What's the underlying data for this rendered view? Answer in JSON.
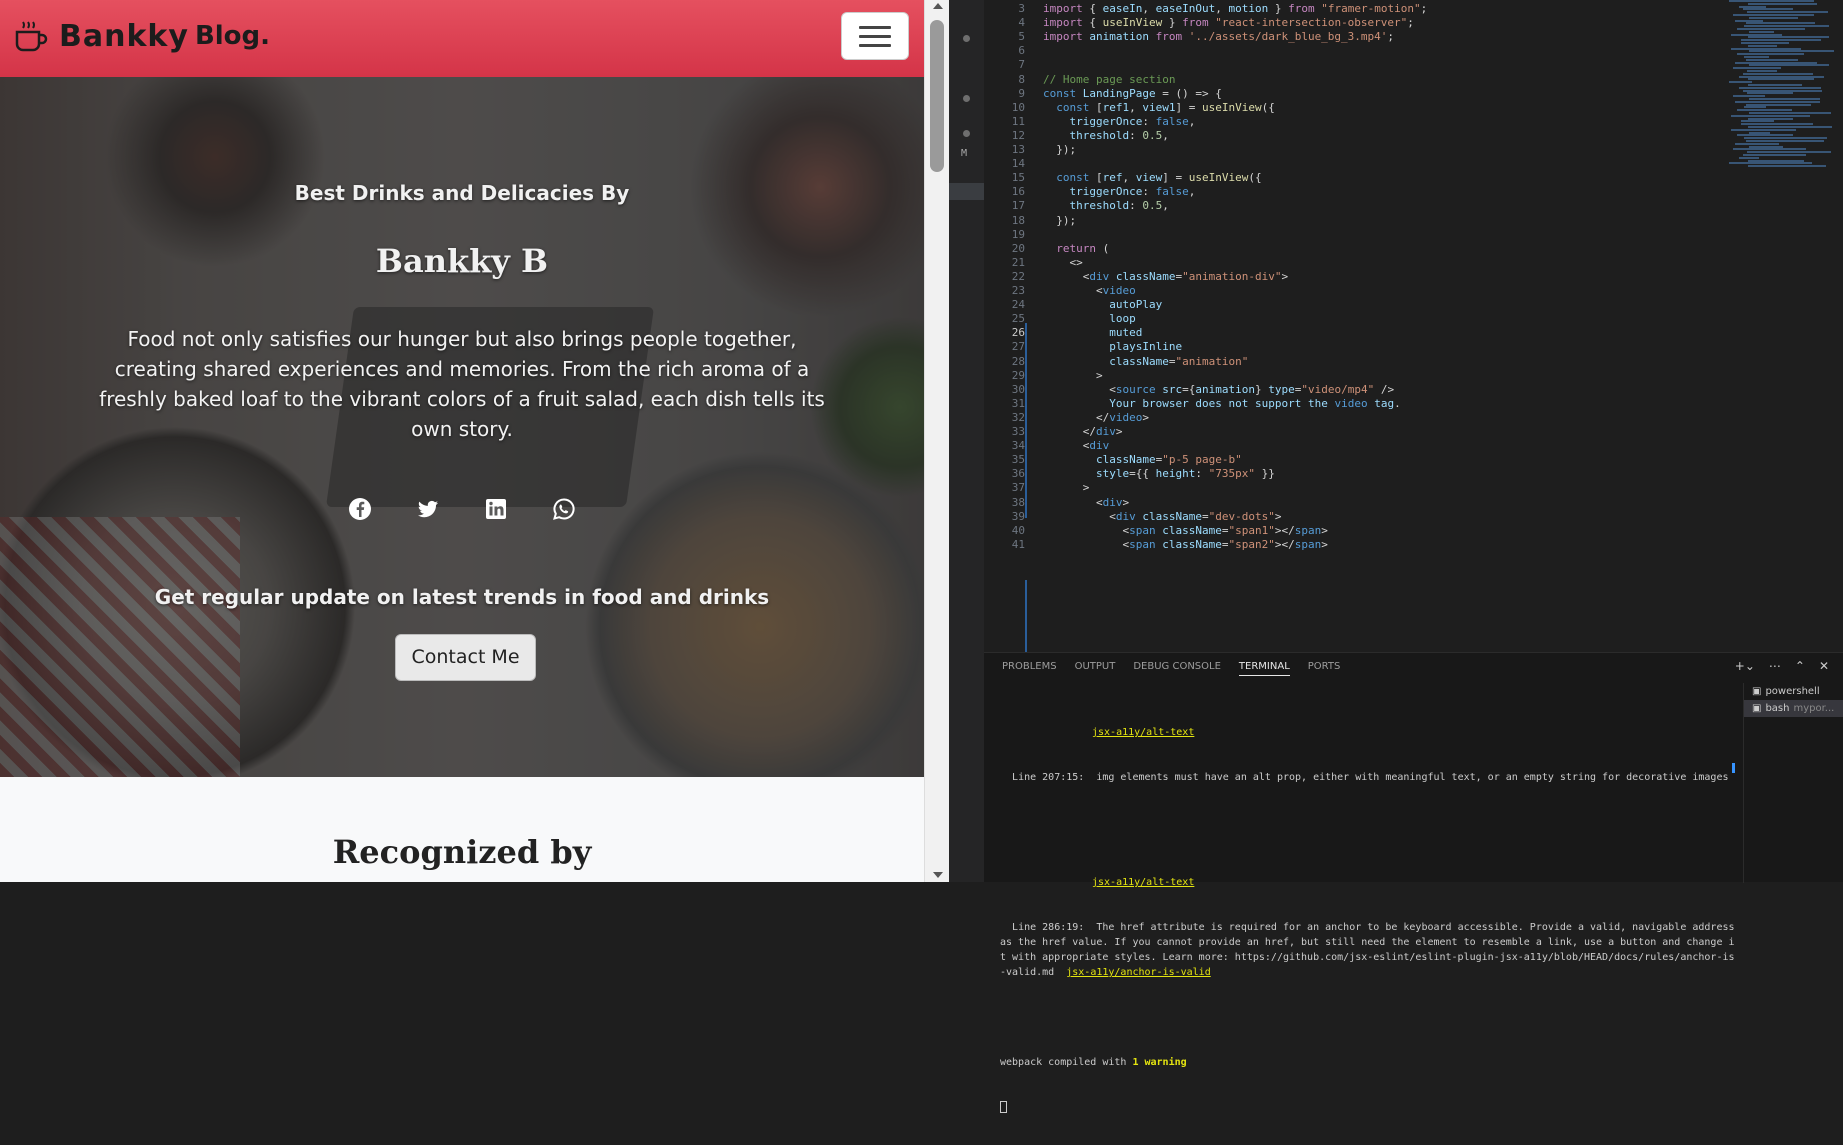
{
  "browser": {
    "navbar": {
      "brand_word": "Bankky",
      "brand_suffix": "Blog.",
      "toggler_label": "Toggle navigation"
    },
    "hero": {
      "subtitle": "Best Drinks and Delicacies By",
      "name": "Bankky B",
      "description": "Food not only satisfies our hunger but also brings people together, creating shared experiences and memories. From the rich aroma of a freshly baked loaf to the vibrant colors of a fruit salad, each dish tells its own story.",
      "social_icons": [
        "facebook-icon",
        "twitter-icon",
        "linkedin-icon",
        "whatsapp-icon"
      ],
      "update_text": "Get regular update on latest trends in food and drinks",
      "contact_button": "Contact Me"
    },
    "section_title": "Recognized by"
  },
  "editor": {
    "current_line": 26,
    "lines": [
      {
        "n": 3,
        "code": "import { easeIn, easeInOut, motion } from \"framer-motion\";"
      },
      {
        "n": 4,
        "code": "import { useInView } from \"react-intersection-observer\";"
      },
      {
        "n": 5,
        "code": "import animation from '../assets/dark_blue_bg_3.mp4';"
      },
      {
        "n": 6,
        "code": ""
      },
      {
        "n": 7,
        "code": ""
      },
      {
        "n": 8,
        "code": "// Home page section"
      },
      {
        "n": 9,
        "code": "const LandingPage = () => {"
      },
      {
        "n": 10,
        "code": "  const [ref1, view1] = useInView({"
      },
      {
        "n": 11,
        "code": "    triggerOnce: false,"
      },
      {
        "n": 12,
        "code": "    threshold: 0.5,"
      },
      {
        "n": 13,
        "code": "  });"
      },
      {
        "n": 14,
        "code": ""
      },
      {
        "n": 15,
        "code": "  const [ref, view] = useInView({"
      },
      {
        "n": 16,
        "code": "    triggerOnce: false,"
      },
      {
        "n": 17,
        "code": "    threshold: 0.5,"
      },
      {
        "n": 18,
        "code": "  });"
      },
      {
        "n": 19,
        "code": ""
      },
      {
        "n": 20,
        "code": "  return ("
      },
      {
        "n": 21,
        "code": "    <>"
      },
      {
        "n": 22,
        "code": "      <div className=\"animation-div\">"
      },
      {
        "n": 23,
        "code": "        <video"
      },
      {
        "n": 24,
        "code": "          autoPlay"
      },
      {
        "n": 25,
        "code": "          loop"
      },
      {
        "n": 26,
        "code": "          muted"
      },
      {
        "n": 27,
        "code": "          playsInline"
      },
      {
        "n": 28,
        "code": "          className=\"animation\""
      },
      {
        "n": 29,
        "code": "        >"
      },
      {
        "n": 30,
        "code": "          <source src={animation} type=\"video/mp4\" />"
      },
      {
        "n": 31,
        "code": "          Your browser does not support the video tag."
      },
      {
        "n": 32,
        "code": "        </video>"
      },
      {
        "n": 33,
        "code": "      </div>"
      },
      {
        "n": 34,
        "code": "      <div"
      },
      {
        "n": 35,
        "code": "        className=\"p-5 page-b\""
      },
      {
        "n": 36,
        "code": "        style={{ height: \"735px\" }}"
      },
      {
        "n": 37,
        "code": "      >"
      },
      {
        "n": 38,
        "code": "        <div>"
      },
      {
        "n": 39,
        "code": "          <div className=\"dev-dots\">"
      },
      {
        "n": 40,
        "code": "            <span className=\"span1\"></span>"
      },
      {
        "n": 41,
        "code": "            <span className=\"span2\"></span>"
      }
    ],
    "gutter_marker": "M"
  },
  "panel": {
    "tabs": [
      "PROBLEMS",
      "OUTPUT",
      "DEBUG CONSOLE",
      "TERMINAL",
      "PORTS"
    ],
    "active_tab": "TERMINAL",
    "terminal": {
      "rule1": "jsx-a11y/alt-text",
      "msg1": "  Line 207:15:  img elements must have an alt prop, either with meaningful text, or an empty string for decorative images",
      "rule2": "jsx-a11y/alt-text",
      "msg2": "  Line 286:19:  The href attribute is required for an anchor to be keyboard accessible. Provide a valid, navigable address as the href value. If you cannot provide an href, but still need the element to resemble a link, use a button and change it with appropriate styles. Learn more: https://github.com/jsx-eslint/eslint-plugin-jsx-a11y/blob/HEAD/docs/rules/anchor-is-valid.md",
      "rule3": "jsx-a11y/anchor-is-valid",
      "compiled_prefix": "webpack compiled with ",
      "compiled_warning": "1 warning"
    },
    "shells": [
      {
        "name": "powershell",
        "sub": ""
      },
      {
        "name": "bash",
        "sub": "mypor..."
      }
    ]
  },
  "colors": {
    "navbar": "#d43448",
    "keyword": "#569cd6",
    "control": "#c586c0",
    "string": "#ce9178",
    "comment": "#6a9955",
    "function": "#dcdcaa",
    "variable": "#9cdcfe"
  }
}
